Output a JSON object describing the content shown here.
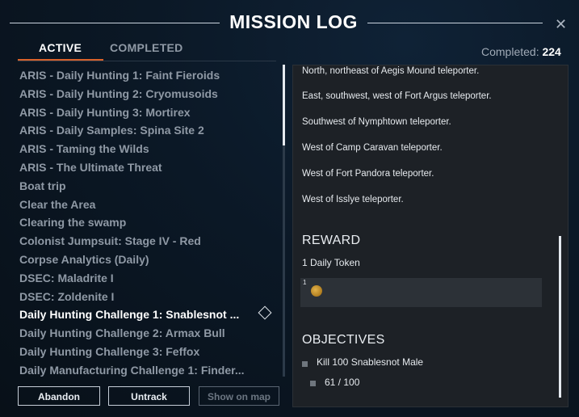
{
  "header": {
    "title": "MISSION LOG",
    "close_icon": "close-icon"
  },
  "tabs": {
    "active_label": "ACTIVE",
    "completed_label": "COMPLETED"
  },
  "completed": {
    "label": "Completed:",
    "count": "224"
  },
  "quests": [
    "ARIS - Daily Hunting 1: Faint Fieroids",
    "ARIS - Daily Hunting 2: Cryomusoids",
    "ARIS - Daily Hunting 3: Mortirex",
    "ARIS - Daily Samples: Spina Site 2",
    "ARIS - Taming the Wilds",
    "ARIS - The Ultimate Threat",
    "Boat trip",
    "Clear the Area",
    "Clearing the swamp",
    "Colonist Jumpsuit: Stage IV - Red",
    "Corpse Analytics (Daily)",
    "DSEC: Maladrite I",
    "DSEC: Zoldenite I",
    "Daily Hunting Challenge 1: Snablesnot ...",
    "Daily Hunting Challenge 2: Armax Bull",
    "Daily Hunting Challenge 3: Feffox",
    "Daily Manufacturing Challenge 1: Finder..."
  ],
  "selected_quest_index": 13,
  "selected_icon": "diamond-tracked-icon",
  "buttons": {
    "abandon": "Abandon",
    "untrack": "Untrack",
    "show_on_map": "Show on map"
  },
  "detail": {
    "locations": [
      "North, northeast of Aegis Mound teleporter.",
      "East, southwest, west of Fort Argus teleporter.",
      "Southwest of Nymphtown teleporter.",
      "West of Camp Caravan teleporter.",
      "West of Fort Pandora teleporter.",
      "West of Isslye teleporter."
    ],
    "reward_title": "REWARD",
    "reward_text": "1 Daily Token",
    "reward_quantity": "1",
    "reward_icon": "daily-token-icon",
    "objectives_title": "OBJECTIVES",
    "objective": "Kill 100 Snablesnot Male",
    "progress": "61 / 100"
  }
}
